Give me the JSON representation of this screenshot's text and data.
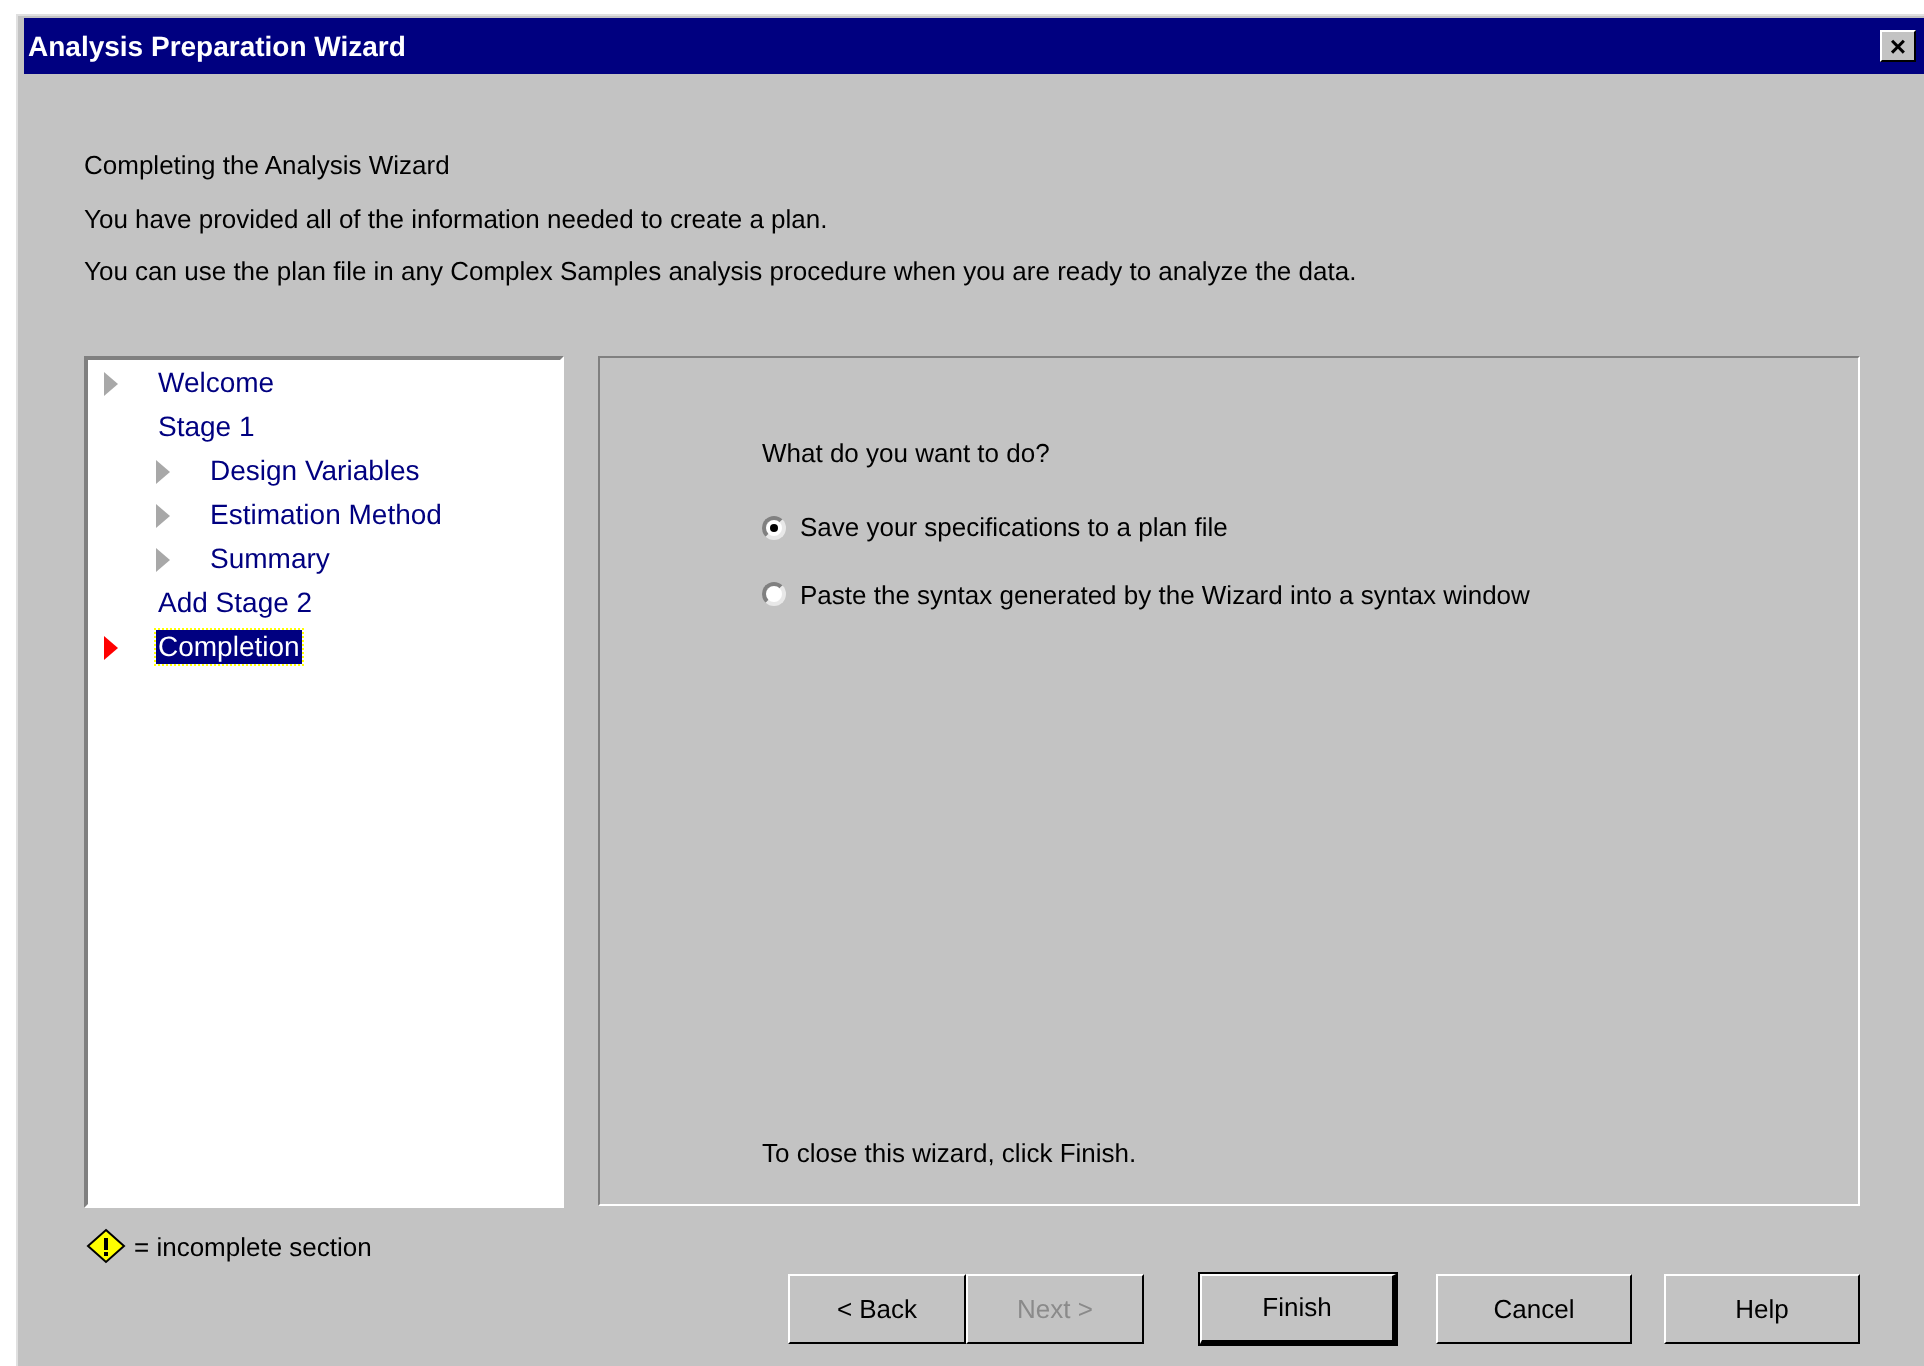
{
  "window": {
    "title": "Analysis Preparation Wizard",
    "close": "×"
  },
  "intro": [
    "Completing the Analysis Wizard",
    "You have provided all of the information needed to create a plan.",
    "You can use the plan file in any Complex Samples analysis procedure when you are ready to analyze the data."
  ],
  "steps": [
    {
      "label": "Welcome",
      "kind": "visited",
      "selected": false
    },
    {
      "label": "Stage 1",
      "kind": "group",
      "selected": false,
      "children": [
        {
          "label": "Design Variables",
          "kind": "visited",
          "selected": false
        },
        {
          "label": "Estimation Method",
          "kind": "visited",
          "selected": false
        },
        {
          "label": "Summary",
          "kind": "visited",
          "selected": false
        }
      ]
    },
    {
      "label": "Add Stage 2",
      "kind": "group",
      "selected": false
    },
    {
      "label": "Completion",
      "kind": "current",
      "selected": true
    }
  ],
  "question": "What do you want to do?",
  "options": [
    {
      "label": "Save your specifications to a plan file",
      "selected": true
    },
    {
      "label": "Paste the syntax generated by the Wizard into a syntax window",
      "selected": false
    }
  ],
  "closing_note": "To close this wizard, click Finish.",
  "legend": "= incomplete section",
  "buttons": [
    {
      "label": "< Back",
      "disabled": false,
      "default": false
    },
    {
      "label": "Next >",
      "disabled": true,
      "default": false
    },
    {
      "label": "Finish",
      "disabled": false,
      "default": true
    },
    {
      "label": "Cancel",
      "disabled": false,
      "default": false
    },
    {
      "label": "Help",
      "disabled": false,
      "default": false
    }
  ]
}
